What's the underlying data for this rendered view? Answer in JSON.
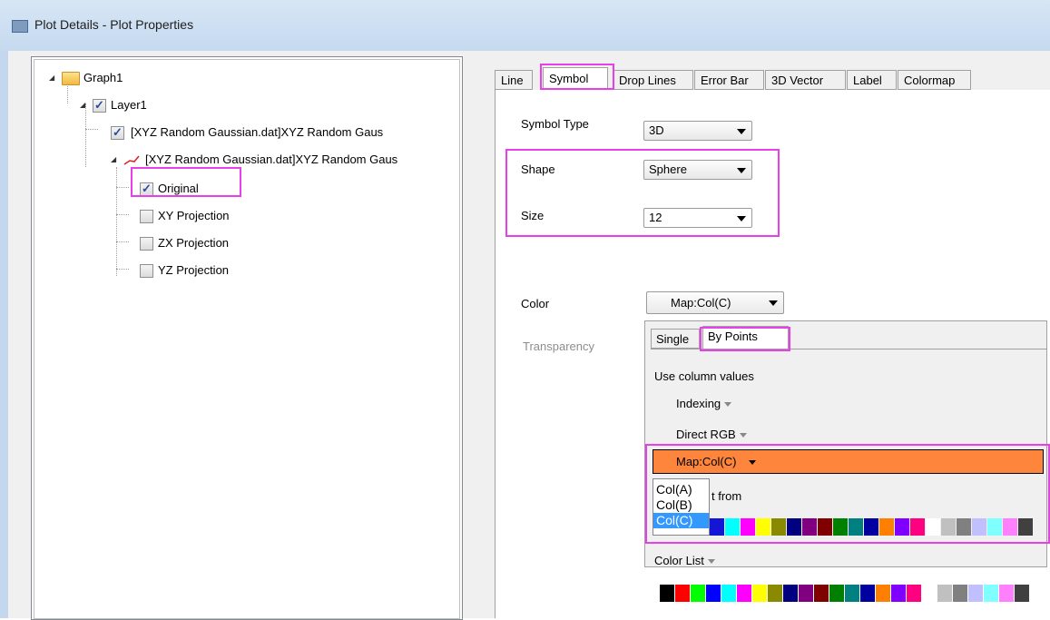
{
  "window": {
    "title": "Plot Details - Plot Properties"
  },
  "tree": {
    "graph": "Graph1",
    "layer": "Layer1",
    "plot1": "[XYZ Random Gaussian.dat]XYZ Random Gaus",
    "plot2": "[XYZ Random Gaussian.dat]XYZ Random Gaus",
    "children": [
      "Original",
      "XY Projection",
      "ZX Projection",
      "YZ Projection"
    ]
  },
  "tabs": [
    "Line",
    "Symbol",
    "Drop Lines",
    "Error Bar",
    "3D Vector",
    "Label",
    "Colormap"
  ],
  "symbol": {
    "type_label": "Symbol Type",
    "type_value": "3D",
    "shape_label": "Shape",
    "shape_value": "Sphere",
    "size_label": "Size",
    "size_value": "12",
    "color_label": "Color",
    "color_value": "Map:Col(C)",
    "transparency_label": "Transparency"
  },
  "color_popup": {
    "tab_single": "Single",
    "tab_bypoints": "By Points",
    "use_column_values": "Use column values",
    "indexing": "Indexing",
    "direct_rgb": "Direct RGB",
    "map_item": "Map:Col(C)",
    "increment_from": "t from",
    "color_list": "Color List",
    "columns": [
      "Col(A)",
      "Col(B)",
      "Col(C)"
    ],
    "selected_column": "Col(C)"
  },
  "swatch_row1": [
    "#1515d6",
    "#00ffff",
    "#ff00ff",
    "#ffff00",
    "#8a8a00",
    "#000080",
    "#800080",
    "#800000",
    "#008000",
    "#008080",
    "#0000a0",
    "#ff8000",
    "#8000ff",
    "#ff0080",
    "#ffffff",
    "#c0c0c0",
    "#808080",
    "#c0c0ff",
    "#80ffff",
    "#ff80ff",
    "#404040"
  ],
  "swatch_row2": [
    "#000000",
    "#ff0000",
    "#00ff00",
    "#0000ff",
    "#00ffff",
    "#ff00ff",
    "#ffff00",
    "#8a8a00",
    "#000080",
    "#800080",
    "#800000",
    "#008000",
    "#008080",
    "#0000a0",
    "#ff8000",
    "#8000ff",
    "#ff0080",
    "#ffffff",
    "#c0c0c0",
    "#808080",
    "#c0c0ff",
    "#80ffff",
    "#ff80ff",
    "#404040"
  ]
}
